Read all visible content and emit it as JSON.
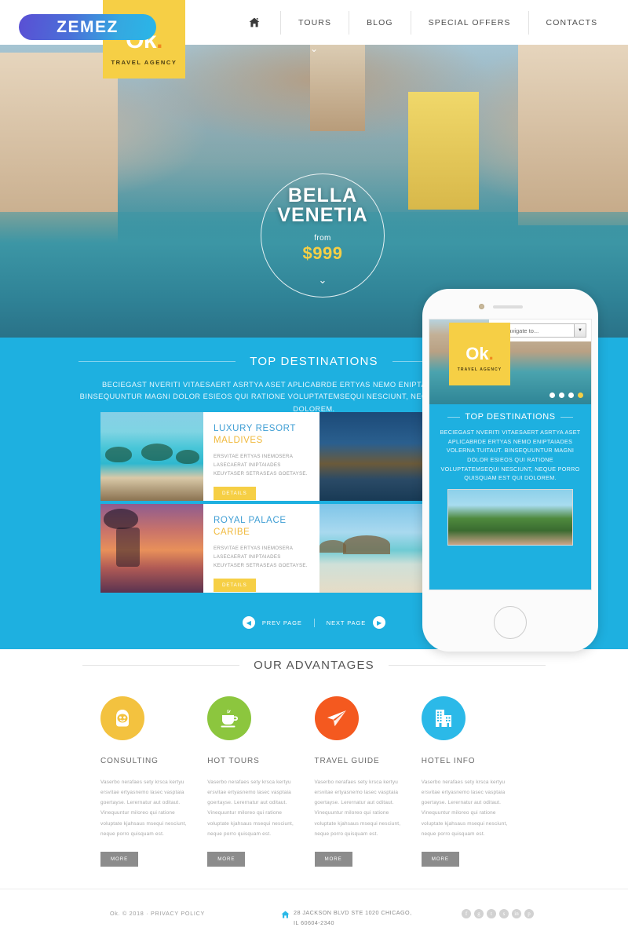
{
  "branding": {
    "zemez_badge": "ZEMEZ",
    "logo_main": "Ok",
    "logo_dot": ".",
    "logo_sub": "TRAVEL AGENCY",
    "accent_yellow": "#f6cf45",
    "accent_blue": "#1eb0e0",
    "accent_orange": "#f08a1e"
  },
  "nav": {
    "home_icon": "home-icon",
    "items": [
      {
        "label": "TOURS"
      },
      {
        "label": "BLOG"
      },
      {
        "label": "SPECIAL OFFERS"
      },
      {
        "label": "CONTACTS"
      }
    ]
  },
  "hero": {
    "title_line1": "BELLA",
    "title_line2": "VENETIA",
    "from_label": "from",
    "price": "$999",
    "chevron": "⌄",
    "scroll_chevron": "⌄"
  },
  "destinations": {
    "section_title": "TOP DESTINATIONS",
    "description": "BECIEGAST NVERITI VITAESAERT ASRTYA ASET APLICABRDE ERTYAS NEMO ENIPTAIADES VOLERNA TUITAUT. BINSEQUUNTUR MAGNI DOLOR ESIEOS QUI RATIONE VOLUPTATEMSEQUI NESCIUNT, NEQUE PORRO QUISQUAM EST QUI DOLOREM.",
    "cards": [
      {
        "title": "LUXURY RESORT",
        "subtitle": "MALDIVES",
        "text": "ERSVITAE ERTYAS INEMOSERA LASECAERAT INIPTAIADES KEUYTASER SETRASEAS GOETAYSE.",
        "button": "DETAILS"
      },
      {
        "title": "ROYAL PALACE",
        "subtitle": "CARIBE",
        "text": "ERSVITAE ERTYAS INEMOSERA LASECAERAT INIPTAIADES KEUYTASER SETRASEAS GOETAYSE.",
        "button": "DETAILS"
      }
    ],
    "pager": {
      "prev_label": "PREV PAGE",
      "next_label": "NEXT PAGE",
      "prev_icon": "◀",
      "next_icon": "▶"
    }
  },
  "phone": {
    "select_value": "Navigate to...",
    "select_arrow": "▼",
    "logo_main": "Ok",
    "logo_dot": ".",
    "logo_sub": "TRAVEL AGENCY",
    "section_title": "TOP DESTINATIONS",
    "description": "BECIEGAST NVERITI VITAESAERT ASRTYA ASET APLICABRDE ERTYAS NEMO ENIPTAIADES VOLERNA TUITAUT. BINSEQUUNTUR MAGNI DOLOR ESIEOS QUI RATIONE VOLUPTATEMSEQUI NESCIUNT, NEQUE PORRO QUISQUAM EST QUI DOLOREM.",
    "slider_dots": 4,
    "active_dot": 4
  },
  "advantages": {
    "section_title": "OUR ADVANTAGES",
    "items": [
      {
        "icon": "consultant-person-icon",
        "color": "#f3c23f",
        "title": "CONSULTING",
        "text": "Vaserbo nerafaes sety krsca kertyu ersvitae ertyasnemo lasec vasptaia goertayse. Lerernatur aut oditaut. Vinequuntur miloreo qui ratione voluptate kjahsaus msequi nesciunt, neque porro quisquam est.",
        "button": "MORE"
      },
      {
        "icon": "coffee-cup-icon",
        "color": "#8cc63e",
        "title": "HOT TOURS",
        "text": "Vaserbo nerafaes sety krsca kertyu ersvitae ertyasnemo lasec vasptaia goertayse. Lerernatur aut oditaut. Vinequuntur miloreo qui ratione voluptate kjahsaus msequi nesciunt, neque porro quisquam est.",
        "button": "MORE"
      },
      {
        "icon": "paper-plane-icon",
        "color": "#f4591f",
        "title": "TRAVEL GUIDE",
        "text": "Vaserbo nerafaes sety krsca kertyu ersvitae ertyasnemo lasec vasptaia goertayse. Lerernatur aut oditaut. Vinequuntur miloreo qui ratione voluptate kjahsaus msequi nesciunt, neque porro quisquam est.",
        "button": "MORE"
      },
      {
        "icon": "building-icon",
        "color": "#2bb9e8",
        "title": "HOTEL INFO",
        "text": "Vaserbo nerafaes sety krsca kertyu ersvitae ertyasnemo lasec vasptaia goertayse. Lerernatur aut oditaut. Vinequuntur miloreo qui ratione voluptate kjahsaus msequi nesciunt, neque porro quisquam est.",
        "button": "MORE"
      }
    ]
  },
  "footer": {
    "copyright": "Ok. © 2018  ·  PRIVACY POLICY",
    "address_icon": "home-icon",
    "address_line1": "28 JACKSON BLVD STE 1020 CHICAGO,",
    "address_line2": "IL 60604-2340",
    "social": [
      {
        "name": "facebook-icon",
        "glyph": "f"
      },
      {
        "name": "google-plus-icon",
        "glyph": "g"
      },
      {
        "name": "twitter-icon",
        "glyph": "t"
      },
      {
        "name": "skype-icon",
        "glyph": "s"
      },
      {
        "name": "linkedin-icon",
        "glyph": "in"
      },
      {
        "name": "pinterest-icon",
        "glyph": "p"
      }
    ]
  }
}
